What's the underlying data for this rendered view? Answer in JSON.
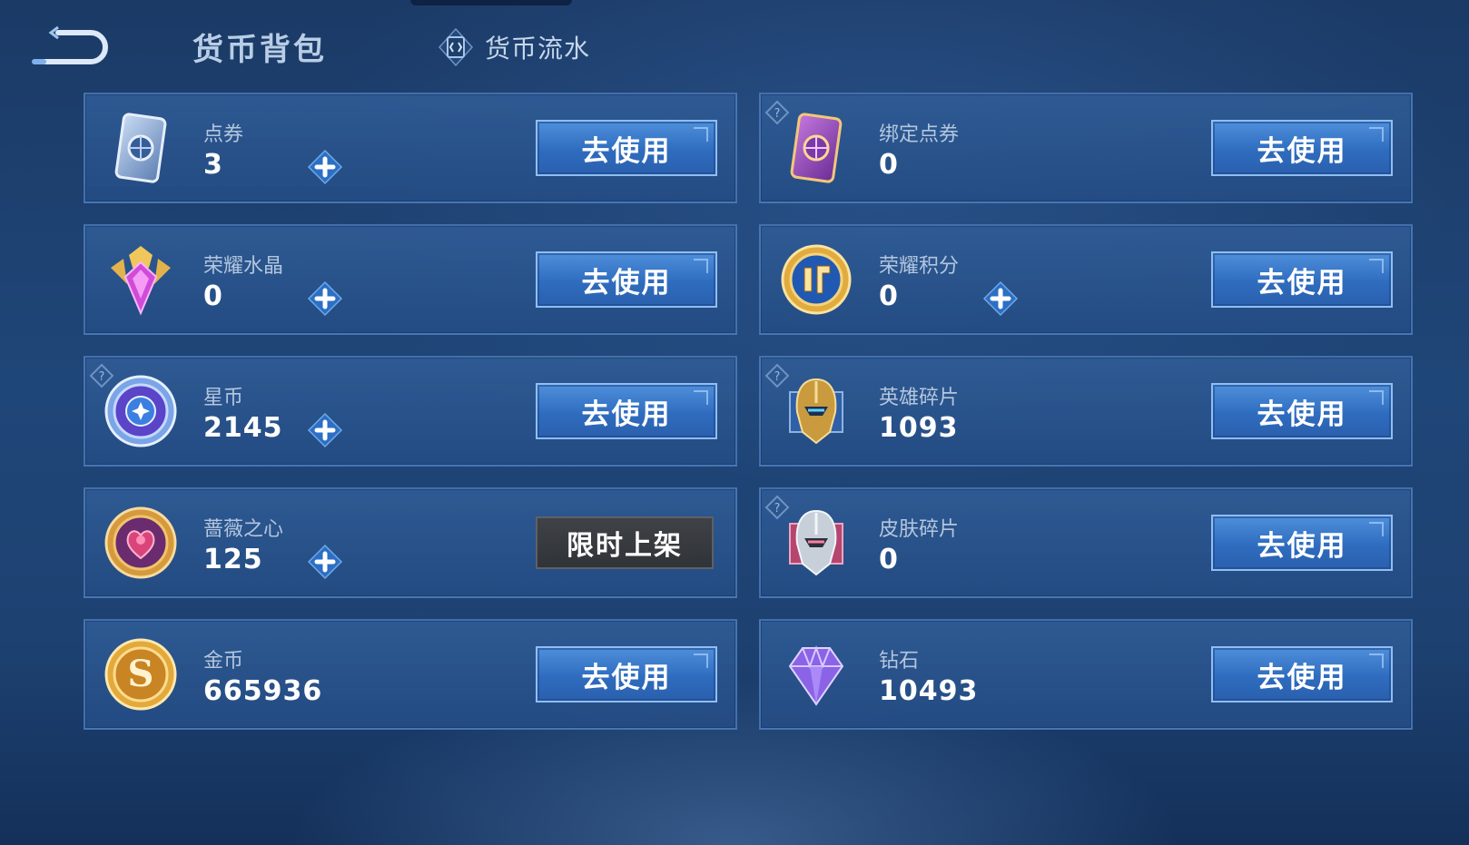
{
  "header": {
    "title": "货币背包",
    "ledger_tab_label": "货币流水"
  },
  "currencies": [
    {
      "name": "点券",
      "value": "3",
      "action": "去使用",
      "has_plus": true,
      "has_help": false,
      "icon": "coupon-card-icon"
    },
    {
      "name": "绑定点券",
      "value": "0",
      "action": "去使用",
      "has_plus": false,
      "has_help": true,
      "icon": "bound-coupon-card-icon"
    },
    {
      "name": "荣耀水晶",
      "value": "0",
      "action": "去使用",
      "has_plus": true,
      "has_help": false,
      "icon": "glory-crystal-icon"
    },
    {
      "name": "荣耀积分",
      "value": "0",
      "action": "去使用",
      "has_plus": true,
      "has_help": false,
      "icon": "glory-points-icon"
    },
    {
      "name": "星币",
      "value": "2145",
      "action": "去使用",
      "has_plus": true,
      "has_help": true,
      "icon": "star-coin-icon"
    },
    {
      "name": "英雄碎片",
      "value": "1093",
      "action": "去使用",
      "has_plus": false,
      "has_help": true,
      "icon": "hero-fragment-icon"
    },
    {
      "name": "蔷薇之心",
      "value": "125",
      "action": "限时上架",
      "has_plus": true,
      "has_help": false,
      "icon": "rose-heart-icon"
    },
    {
      "name": "皮肤碎片",
      "value": "0",
      "action": "去使用",
      "has_plus": false,
      "has_help": true,
      "icon": "skin-fragment-icon"
    },
    {
      "name": "金币",
      "value": "665936",
      "action": "去使用",
      "has_plus": false,
      "has_help": false,
      "icon": "gold-coin-icon"
    },
    {
      "name": "钻石",
      "value": "10493",
      "action": "去使用",
      "has_plus": false,
      "has_help": false,
      "icon": "diamond-icon"
    }
  ],
  "colors": {
    "background": "#1f4678",
    "card": "#305c96",
    "use_button": "#3a7bd0",
    "limited_button": "#3a3d42"
  },
  "icons": {
    "back": "back-arrow-icon",
    "ledger": "ledger-icon",
    "help": "question-icon",
    "plus": "plus-icon"
  }
}
